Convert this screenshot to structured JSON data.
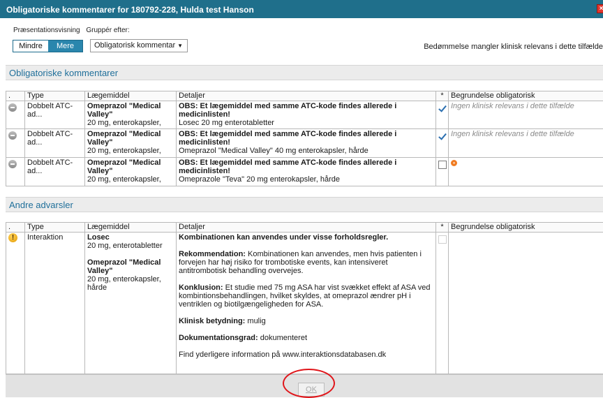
{
  "window": {
    "title": "Obligatoriske kommentarer for 180792-228, Hulda test Hanson"
  },
  "controls": {
    "presentation_label": "Præsentationsvisning",
    "group_label": "Gruppér efter:",
    "less_label": "Mindre",
    "more_label": "Mere",
    "group_value": "Obligatorisk kommentar",
    "right_note": "Bedømmelse mangler klinisk relevans i dette tilfælde"
  },
  "headers": {
    "dot": ".",
    "type": "Type",
    "drug": "Lægemiddel",
    "details": "Detaljer",
    "star": "*",
    "reason": "Begrundelse obligatorisk"
  },
  "mandatory": {
    "title": "Obligatoriske kommentarer",
    "rows": [
      {
        "type": "Dobbelt ATC-ad...",
        "drug_name": "Omeprazol \"Medical Valley\"",
        "drug_form": "20 mg, enterokapsler,",
        "detail_bold": "OBS: Et lægemiddel med samme ATC-kode findes allerede i medicinlisten!",
        "detail_text": "Losec 20 mg enterotabletter",
        "checked": "true",
        "reason": "Ingen klinisk relevans i dette tilfælde"
      },
      {
        "type": "Dobbelt ATC-ad...",
        "drug_name": "Omeprazol \"Medical Valley\"",
        "drug_form": "20 mg, enterokapsler,",
        "detail_bold": "OBS: Et lægemiddel med samme ATC-kode findes allerede i medicinlisten!",
        "detail_text": "Omeprazol \"Medical Valley\" 40 mg enterokapsler, hårde",
        "checked": "true",
        "reason": "Ingen klinisk relevans i dette tilfælde"
      },
      {
        "type": "Dobbelt ATC-ad...",
        "drug_name": "Omeprazol \"Medical Valley\"",
        "drug_form": "20 mg, enterokapsler,",
        "detail_bold": "OBS: Et lægemiddel med samme ATC-kode findes allerede i medicinlisten!",
        "detail_text": "Omeprazole \"Teva\" 20 mg enterokapsler, hårde",
        "checked": "false",
        "reason": ""
      }
    ]
  },
  "other": {
    "title": "Andre advarsler",
    "row": {
      "icon_glyph": "!",
      "type": "Interaktion",
      "drug1_name": "Losec",
      "drug1_form": "20 mg, enterotabletter",
      "drug2_name": "Omeprazol \"Medical Valley\"",
      "drug2_form": "20 mg, enterokapsler, hårde",
      "headline": "Kombinationen kan anvendes under visse forholdsregler.",
      "rec_label": "Rekommendation:",
      "rec_text": " Kombinationen kan anvendes, men hvis patienten i forvejen har høj risiko for trombotiske events, kan intensiveret antitrombotisk behandling overvejes.",
      "concl_label": "Konklusion:",
      "concl_text": " Et studie med 75 mg ASA har vist svækket effekt af ASA ved kombintionsbehandlingen, hvilket skyldes, at omeprazol ændrer pH i ventriklen og biotilgængeligheden for ASA.",
      "clin_label": "Klinisk betydning:",
      "clin_text": " mulig",
      "doc_label": "Dokumentationsgrad:",
      "doc_text": " dokumenteret",
      "more_info": "Find yderligere information på www.interaktionsdatabasen.dk"
    }
  },
  "footer": {
    "ok_label": "OK"
  },
  "colors": {
    "titlebar": "#1f6f8b",
    "accent": "#2a86ad",
    "highlight_ring": "#e0161b"
  }
}
